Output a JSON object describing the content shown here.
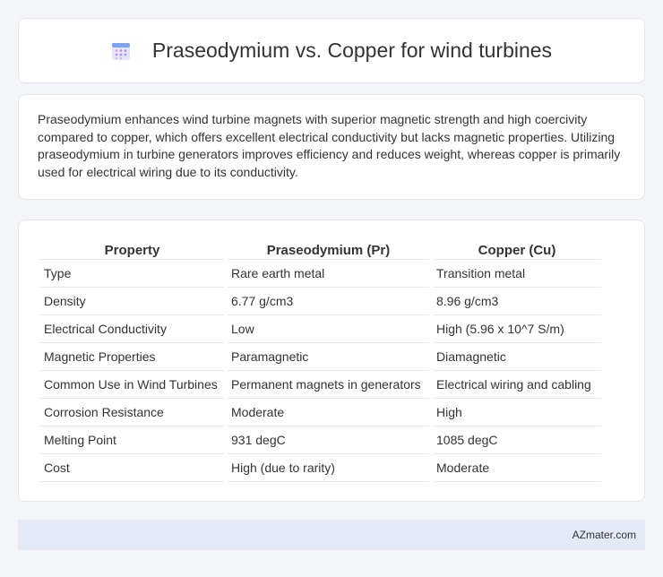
{
  "header": {
    "icon": "calendar-icon",
    "title": "Praseodymium vs. Copper for wind turbines"
  },
  "intro": {
    "text": "Praseodymium enhances wind turbine magnets with superior magnetic strength and high coercivity compared to copper, which offers excellent electrical conductivity but lacks magnetic properties. Utilizing praseodymium in turbine generators improves efficiency and reduces weight, whereas copper is primarily used for electrical wiring due to its conductivity."
  },
  "table": {
    "headers": [
      "Property",
      "Praseodymium (Pr)",
      "Copper (Cu)"
    ],
    "rows": [
      [
        "Type",
        "Rare earth metal",
        "Transition metal"
      ],
      [
        "Density",
        "6.77 g/cm3",
        "8.96 g/cm3"
      ],
      [
        "Electrical Conductivity",
        "Low",
        "High (5.96 x 10^7 S/m)"
      ],
      [
        "Magnetic Properties",
        "Paramagnetic",
        "Diamagnetic"
      ],
      [
        "Common Use in Wind Turbines",
        "Permanent magnets in generators",
        "Electrical wiring and cabling"
      ],
      [
        "Corrosion Resistance",
        "Moderate",
        "High"
      ],
      [
        "Melting Point",
        "931 degC",
        "1085 degC"
      ],
      [
        "Cost",
        "High (due to rarity)",
        "Moderate"
      ]
    ]
  },
  "footer": {
    "text": "AZmater.com"
  }
}
